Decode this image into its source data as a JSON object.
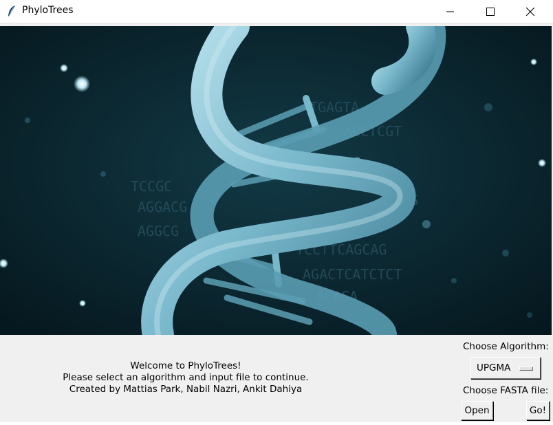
{
  "window": {
    "title": "PhyloTrees",
    "app_icon": "feather-icon",
    "controls": {
      "minimize": "minimize-icon",
      "maximize": "maximize-icon",
      "close": "close-icon"
    }
  },
  "hero": {
    "description_icon": "dna-helix-image",
    "colors": {
      "background": "#082028",
      "helix": "#8ac6d8"
    }
  },
  "welcome": {
    "line1": "Welcome to PhyloTrees!",
    "line2": "Please select an algorithm and input file to continue.",
    "line3": "Created by Mattias Park, Nabil Nazri, Ankit Dahiya"
  },
  "controls": {
    "algorithm_label": "Choose Algorithm:",
    "algorithm_selected": "UPGMA",
    "fasta_label": "Choose FASTA file:",
    "open_label": "Open",
    "go_label": "Go!"
  }
}
